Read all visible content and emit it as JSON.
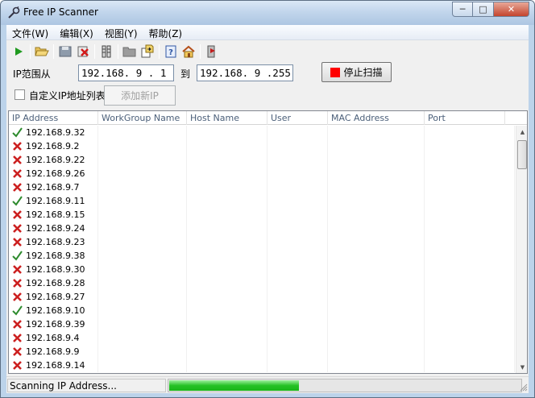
{
  "window": {
    "title": "Free IP Scanner"
  },
  "caption": {
    "minimize": "─",
    "maximize": "□",
    "close": "✕"
  },
  "menu": [
    "文件(W)",
    "编辑(X)",
    "视图(Y)",
    "帮助(Z)"
  ],
  "toolbar": [
    "play-icon",
    "open-folder-icon",
    "save-icon",
    "delete-icon",
    "network-icon",
    "folder-icon",
    "export-icon",
    "help-icon",
    "home-icon",
    "exit-icon"
  ],
  "ip_range": {
    "label": "IP范围从",
    "from": "192.168. 9 . 1",
    "to_label": "到",
    "to": "192.168. 9 .255"
  },
  "stop_button": "停止扫描",
  "custom": {
    "label": "自定义IP地址列表",
    "checked": false,
    "add_button": "添加新IP"
  },
  "columns": [
    "IP Address",
    "WorkGroup Name",
    "Host Name",
    "User",
    "MAC Address",
    "Port"
  ],
  "rows": [
    {
      "ip": "192.168.9.32",
      "status": "up"
    },
    {
      "ip": "192.168.9.2",
      "status": "down"
    },
    {
      "ip": "192.168.9.22",
      "status": "down"
    },
    {
      "ip": "192.168.9.26",
      "status": "down"
    },
    {
      "ip": "192.168.9.7",
      "status": "down"
    },
    {
      "ip": "192.168.9.11",
      "status": "up"
    },
    {
      "ip": "192.168.9.15",
      "status": "down"
    },
    {
      "ip": "192.168.9.24",
      "status": "down"
    },
    {
      "ip": "192.168.9.23",
      "status": "down"
    },
    {
      "ip": "192.168.9.38",
      "status": "up"
    },
    {
      "ip": "192.168.9.30",
      "status": "down"
    },
    {
      "ip": "192.168.9.28",
      "status": "down"
    },
    {
      "ip": "192.168.9.27",
      "status": "down"
    },
    {
      "ip": "192.168.9.10",
      "status": "up"
    },
    {
      "ip": "192.168.9.39",
      "status": "down"
    },
    {
      "ip": "192.168.9.4",
      "status": "down"
    },
    {
      "ip": "192.168.9.9",
      "status": "down"
    },
    {
      "ip": "192.168.9.14",
      "status": "down"
    }
  ],
  "status": {
    "text": "Scanning IP Address...",
    "progress": 0.37
  },
  "colors": {
    "up": "#2e8b2e",
    "down": "#cc1f1f",
    "progress": "#26c226"
  }
}
